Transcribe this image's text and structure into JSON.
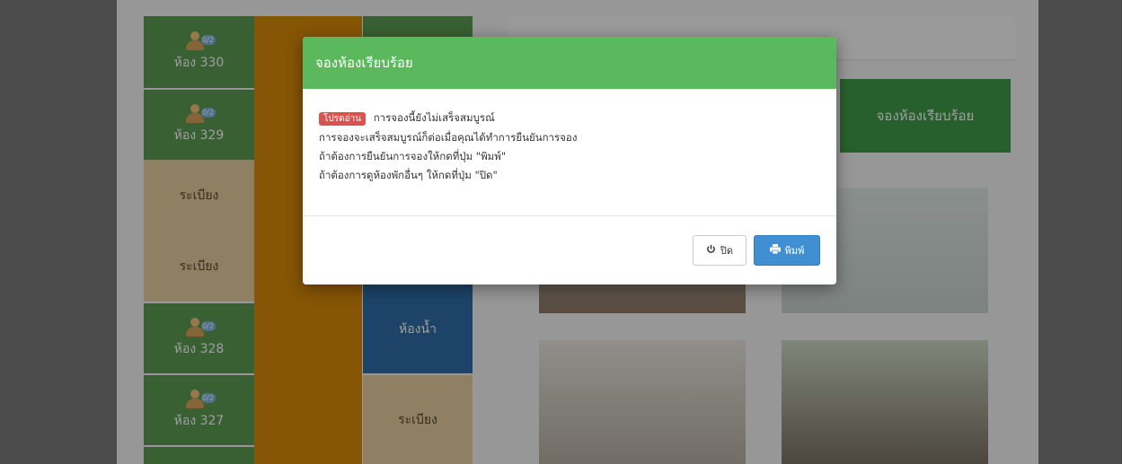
{
  "rooms": [
    {
      "label": "ห้อง 330",
      "badge": "0/2",
      "type": "room"
    },
    {
      "label": "ห้อง 329",
      "badge": "0/2",
      "type": "room"
    },
    {
      "label": "ระเบียง",
      "type": "balcony"
    },
    {
      "label": "ระเบียง",
      "type": "balcony"
    },
    {
      "label": "ห้อง 328",
      "badge": "0/2",
      "type": "room"
    },
    {
      "label": "ห้อง 327",
      "badge": "0/2",
      "type": "room"
    }
  ],
  "middle": {
    "bathroom_label": "ห้องน้ำ",
    "balcony_label": "ระเบียง"
  },
  "right": {
    "book_button_label": "จองห้องเรียบร้อย"
  },
  "modal": {
    "title": "จองห้องเรียบร้อย",
    "badge": "โปรดอ่าน",
    "line1": "การจองนี้ยังไม่เสร็จสมบูรณ์",
    "line2": "การจองจะเสร็จสมบูรณ์ก็ต่อเมื่อคุณได้ทำการยืนยันการจอง",
    "line3": "ถ้าต้องการยืนยันการจองให้กดที่ปุ่ม \"พิมพ์\"",
    "line4": "ถ้าต้องการดูห้องพักอื่นๆ ให้กดที่ปุ่ม \"ปิด\"",
    "close_label": "ปิด",
    "print_label": "พิมพ์"
  },
  "colors": {
    "header_green": "#5cb85c",
    "danger": "#d9534f",
    "primary": "#3f8fd2",
    "orange": "#d9890a"
  }
}
